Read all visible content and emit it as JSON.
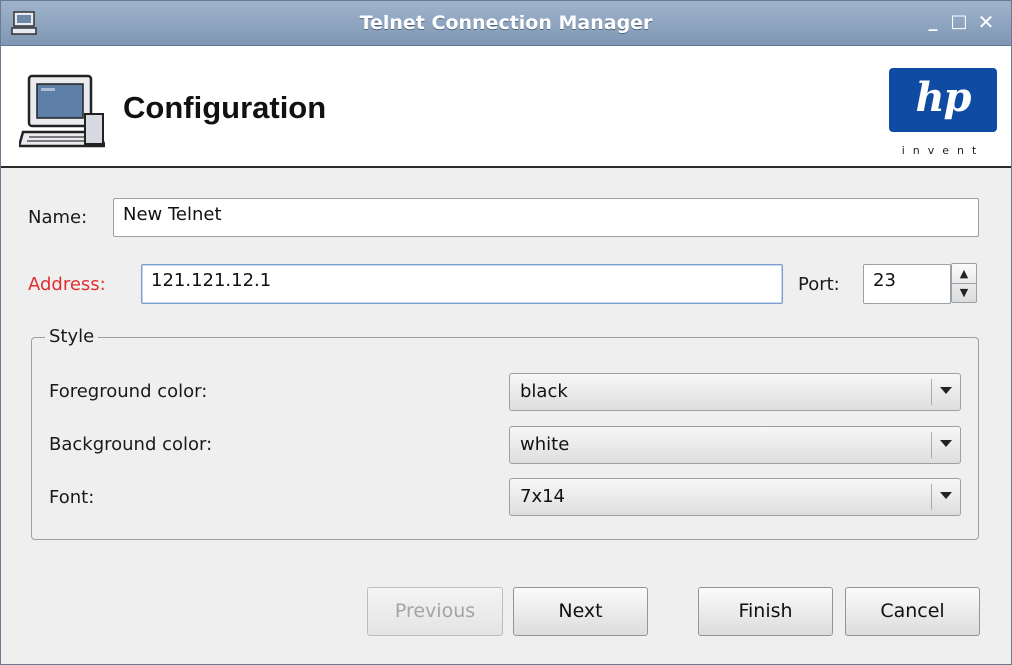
{
  "window": {
    "title": "Telnet Connection Manager",
    "controls": {
      "minimize": "_",
      "maximize": "□",
      "close": "✕"
    }
  },
  "header": {
    "title": "Configuration",
    "icon": "computer-terminal-icon",
    "logo": {
      "mark": "hp",
      "tagline": "invent",
      "color": "#0f4aa3"
    }
  },
  "form": {
    "name": {
      "label": "Name:",
      "value": "New Telnet"
    },
    "address": {
      "label": "Address:",
      "value": "121.121.12.1",
      "label_color": "#e03030"
    },
    "port": {
      "label": "Port:",
      "value": "23"
    }
  },
  "style_group": {
    "legend": "Style",
    "foreground": {
      "label": "Foreground color:",
      "value": "black"
    },
    "background": {
      "label": "Background color:",
      "value": "white"
    },
    "font": {
      "label": "Font:",
      "value": "7x14"
    }
  },
  "buttons": {
    "previous": "Previous",
    "next": "Next",
    "finish": "Finish",
    "cancel": "Cancel"
  }
}
